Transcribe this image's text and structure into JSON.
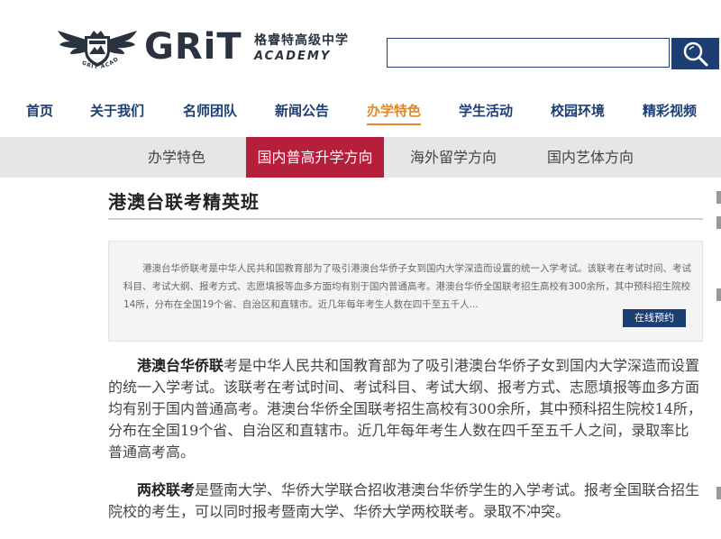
{
  "header": {
    "logo": {
      "wordmark": "GRiT",
      "cn_name": "格睿特高级中学",
      "en_name": "ACADEMY",
      "emblem_text": "GRIT ACADEMY"
    },
    "search": {
      "value": "",
      "placeholder": ""
    }
  },
  "main_nav": {
    "items": [
      {
        "label": "首页"
      },
      {
        "label": "关于我们"
      },
      {
        "label": "名师团队"
      },
      {
        "label": "新闻公告"
      },
      {
        "label": "办学特色"
      },
      {
        "label": "学生活动"
      },
      {
        "label": "校园环境"
      },
      {
        "label": "精彩视频"
      }
    ],
    "active_index": 4
  },
  "sub_nav": {
    "items": [
      {
        "label": "办学特色"
      },
      {
        "label": "国内普高升学方向"
      },
      {
        "label": "海外留学方向"
      },
      {
        "label": "国内艺体方向"
      }
    ],
    "active_index": 1
  },
  "content": {
    "title": "港澳台联考精英班",
    "summary": "港澳台华侨联考是中华人民共和国教育部为了吸引港澳台华侨子女到国内大学深造而设置的统一入学考试。该联考在考试时间、考试科目、考试大纲、报考方式、志愿填报等血多方面均有别于国内普通高考。港澳台华侨全国联考招生高校有300余所，其中预科招生院校14所，分布在全国19个省、自治区和直辖市。近几年每年考生人数在四千至五千人...",
    "reserve_button": "在线预约",
    "paragraphs": [
      {
        "lead": "港澳台华侨联",
        "text": "考是中华人民共和国教育部为了吸引港澳台华侨子女到国内大学深造而设置的统一入学考试。该联考在考试时间、考试科目、考试大纲、报考方式、志愿填报等血多方面均有别于国内普通高考。港澳台华侨全国联考招生高校有300余所，其中预科招生院校14所，分布在全国19个省、自治区和直辖市。近几年每年考生人数在四千至五千人之间，录取率比普通高考高。"
      },
      {
        "lead": "两校联考",
        "text": "是暨南大学、华侨大学联合招收港澳台华侨学生的入学考试。报考全国联合招生院校的考生，可以同时报考暨南大学、华侨大学两校联考。录取不冲突。"
      }
    ]
  },
  "colors": {
    "navy": "#1c3e73",
    "active_orange": "#e0882a",
    "active_red": "#b51f3c",
    "subnav_bg": "#e6e6e6"
  },
  "icons": {
    "search": "search-icon",
    "emblem": "eagle-emblem-icon"
  }
}
